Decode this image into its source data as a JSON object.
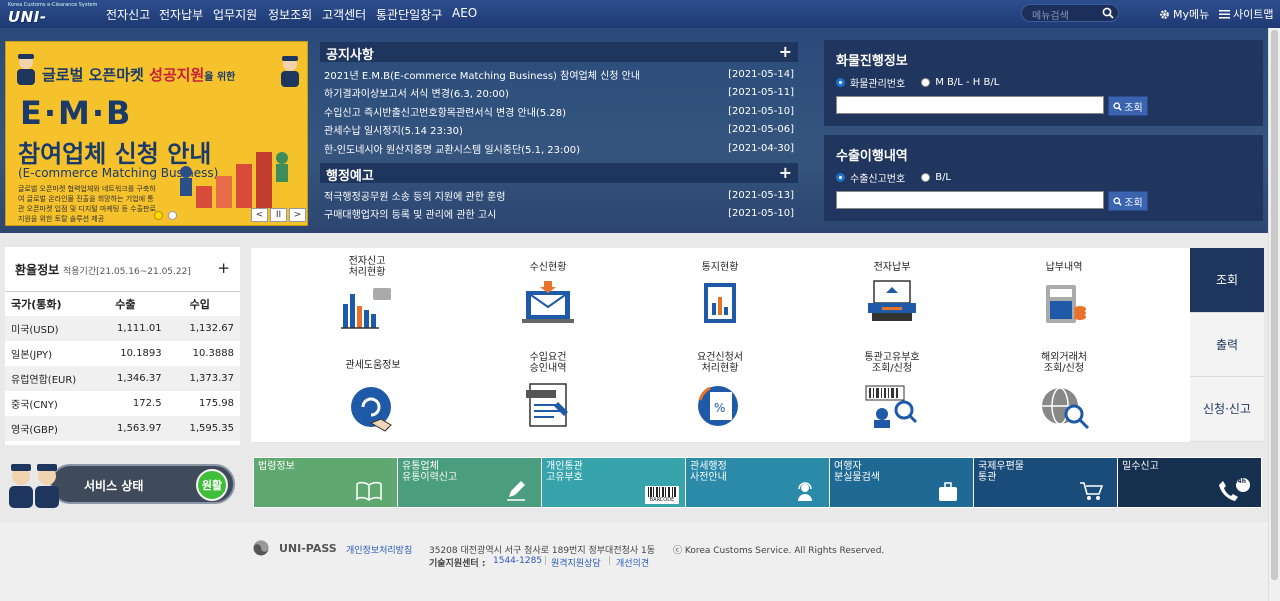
{
  "logo": {
    "small": "Korea Customs e-Clearance System",
    "main": "UNI-PASS"
  },
  "nav": {
    "items": [
      "전자신고",
      "전자납부",
      "업무지원",
      "정보조회",
      "고객센터",
      "통관단일창구",
      "AEO"
    ],
    "search_placeholder": "메뉴검색",
    "my_menu": "My메뉴",
    "sitemap": "사이트맵"
  },
  "banner": {
    "line1": "글로벌 오픈마켓",
    "line1b": "성공지원",
    "line1c": "을 위한",
    "line2": "E·M·B",
    "line3": "참여업체 신청 안내",
    "line4": "(E-commerce Matching Business)",
    "line5": "글로벌 오픈마켓 협력업체와 네트워크를 구축하여 글로벌 온라인몰 진출을 희망하는 기업에 통관 오픈마켓 입점 및 디지털 마케팅 등 수출판로 지원을 위한 토탈 솔루션 제공",
    "prev": "<",
    "pause": "II",
    "next": ">"
  },
  "notices": {
    "title": "공지사항",
    "plus": "+",
    "items": [
      {
        "text": "2021년 E.M.B(E-commerce Matching Business) 참여업체 신청 안내",
        "date": "[2021-05-14]"
      },
      {
        "text": "하기결과이상보고서 서식 변경(6.3, 20:00)",
        "date": "[2021-05-11]"
      },
      {
        "text": "수입신고 즉시반출신고번호항목관련서식 변경 안내(5.28)",
        "date": "[2021-05-10]"
      },
      {
        "text": "관세수납 일시정지(5.14 23:30)",
        "date": "[2021-05-06]"
      },
      {
        "text": "한-인도네시아 원산지증명 교환시스템 일시중단(5.1, 23:00)",
        "date": "[2021-04-30]"
      }
    ]
  },
  "admin": {
    "title": "행정예고",
    "plus": "+",
    "items": [
      {
        "text": "적극행정공무원 소송 등의 지원에 관한 훈령",
        "date": "[2021-05-13]"
      },
      {
        "text": "구매대행업자의 등록 및 관리에 관한 고시",
        "date": "[2021-05-10]"
      }
    ]
  },
  "cargo": {
    "title": "화물진행정보",
    "opt1": "화물관리번호",
    "opt2": "M B/L - H B/L",
    "btn": "조회"
  },
  "export": {
    "title": "수출이행내역",
    "opt1": "수출신고번호",
    "opt2": "B/L",
    "btn": "조회"
  },
  "rates": {
    "title": "환율정보",
    "period": "적용기간[21.05.16~21.05.22]",
    "plus": "+",
    "headers": [
      "국가(통화)",
      "수출",
      "수입"
    ],
    "rows": [
      [
        "미국(USD)",
        "1,111.01",
        "1,132.67"
      ],
      [
        "일본(JPY)",
        "10.1893",
        "10.3888"
      ],
      [
        "유럽연합(EUR)",
        "1,346.37",
        "1,373.37"
      ],
      [
        "중국(CNY)",
        "172.5",
        "175.98"
      ],
      [
        "영국(GBP)",
        "1,563.97",
        "1,595.35"
      ]
    ]
  },
  "quick": {
    "items": [
      "전자신고\n처리현황",
      "수신현황",
      "통지현황",
      "전자납부",
      "납부내역",
      "관세도움정보",
      "수입요건\n승인내역",
      "요건신청서\n처리현황",
      "통관고유부호\n조회/신청",
      "해외거래처\n조회/신청"
    ]
  },
  "tabs": [
    "조회",
    "출력",
    "신청·신고"
  ],
  "service": {
    "label": "서비스 상태",
    "status": "원활"
  },
  "links": [
    {
      "l1": "법령정보",
      "l2": "",
      "color": "#5fa86f"
    },
    {
      "l1": "유통업체",
      "l2": "유통이력신고",
      "color": "#4a9d7e"
    },
    {
      "l1": "개인통관",
      "l2": "고유부호",
      "color": "#37a3ab"
    },
    {
      "l1": "관세행정",
      "l2": "사전안내",
      "color": "#2a8aa8"
    },
    {
      "l1": "여행자",
      "l2": "분실물검색",
      "color": "#1f6a94"
    },
    {
      "l1": "국제우편물",
      "l2": "통관",
      "color": "#1a4c7a"
    },
    {
      "l1": "밀수신고",
      "l2": "",
      "color": "#16304f"
    }
  ],
  "barcode": "BARCODE",
  "hours": "24h",
  "footer": {
    "brand": "UNI-PASS",
    "privacy": "개인정보처리방침",
    "address": "35208 대전광역시 서구 청사로 189번지 정부대전청사 1동",
    "copyright": "ⓒ Korea Customs Service. All Rights Reserved.",
    "tech": "기술지원센터 :",
    "phone": "1544-1285",
    "remote": "원격지원상담",
    "improve": "개선의견"
  }
}
